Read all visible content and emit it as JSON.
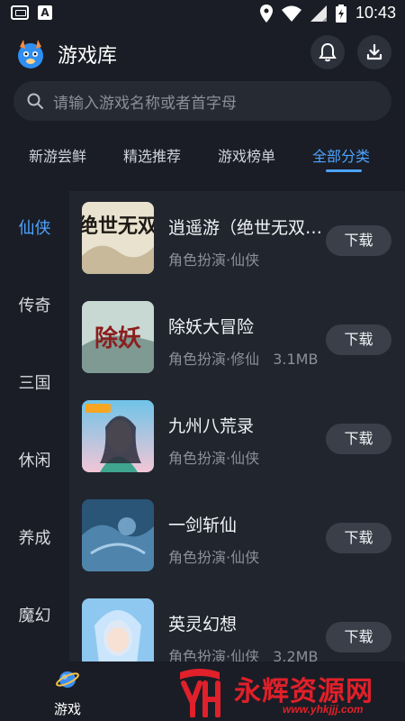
{
  "status_bar": {
    "time": "10:43"
  },
  "header": {
    "title": "游戏库"
  },
  "search": {
    "placeholder": "请输入游戏名称或者首字母"
  },
  "tabs": [
    {
      "label": "新游尝鲜",
      "active": false
    },
    {
      "label": "精选推荐",
      "active": false
    },
    {
      "label": "游戏榜单",
      "active": false
    },
    {
      "label": "全部分类",
      "active": true
    }
  ],
  "sidebar": [
    {
      "label": "仙侠",
      "active": true
    },
    {
      "label": "传奇",
      "active": false
    },
    {
      "label": "三国",
      "active": false
    },
    {
      "label": "休闲",
      "active": false
    },
    {
      "label": "养成",
      "active": false
    },
    {
      "label": "魔幻",
      "active": false
    }
  ],
  "games": [
    {
      "name": "逍遥游（绝世无双…",
      "category": "角色扮演·仙侠",
      "size": "",
      "button": "下载",
      "thumb_text": "绝世无双"
    },
    {
      "name": "除妖大冒险",
      "category": "角色扮演·修仙",
      "size": "3.1MB",
      "button": "下载",
      "thumb_text": "除妖"
    },
    {
      "name": "九州八荒录",
      "category": "角色扮演·仙侠",
      "size": "",
      "button": "下载",
      "thumb_text": ""
    },
    {
      "name": "一剑斩仙",
      "category": "角色扮演·仙侠",
      "size": "",
      "button": "下载",
      "thumb_text": ""
    },
    {
      "name": "英灵幻想",
      "category": "角色扮演·仙侠",
      "size": "3.2MB",
      "button": "下载",
      "thumb_text": ""
    }
  ],
  "bottom_nav": {
    "label": "游戏"
  },
  "watermark": {
    "text": "永辉资源网",
    "url": "www.yhkjjj.com"
  },
  "colors": {
    "accent": "#4da3ff",
    "background": "#1a1d25",
    "panel": "#21252e",
    "button": "#3a3f49"
  }
}
